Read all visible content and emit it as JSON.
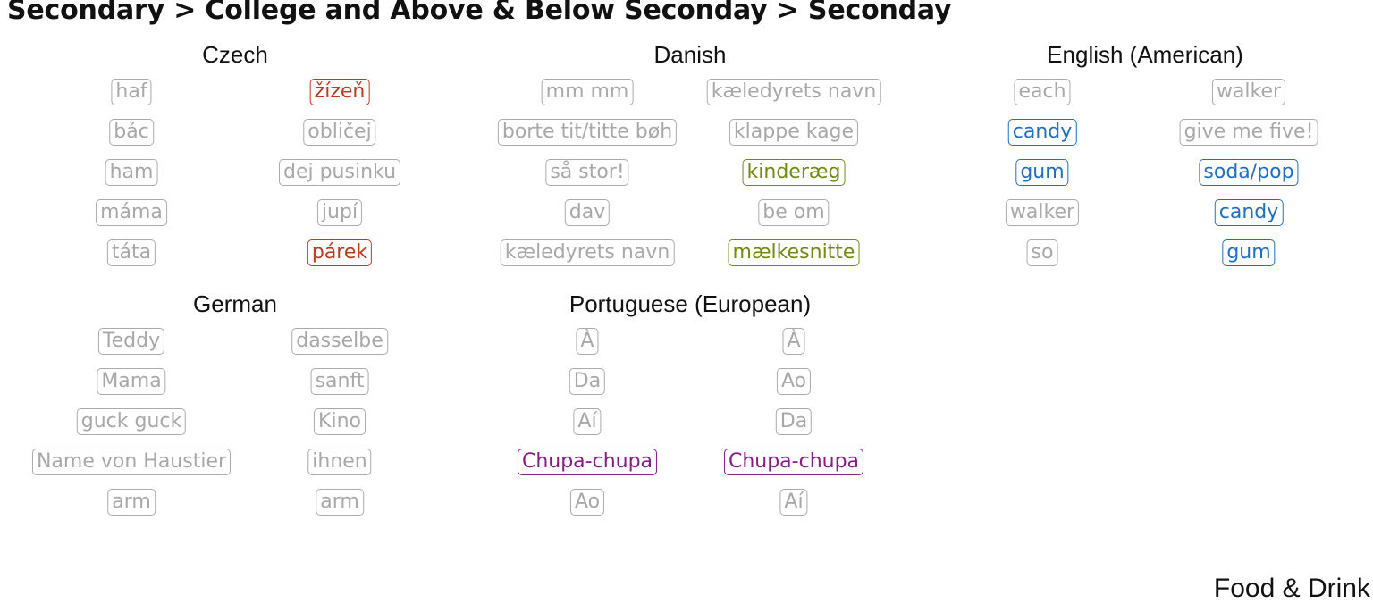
{
  "title": "Secondary > College and Above & Below Seconday > Seconday",
  "footer": "Food & Drink",
  "colors": {
    "default": "#a8a8a8",
    "Czech": "#c0391b",
    "Danish": "#6f8b12",
    "English (American)": "#1f6fc4",
    "Portuguese (European)": "#8a1a8a"
  },
  "panels": [
    {
      "name": "Czech",
      "columns": [
        [
          {
            "text": "haf",
            "hl": false
          },
          {
            "text": "bác",
            "hl": false
          },
          {
            "text": "ham",
            "hl": false
          },
          {
            "text": "máma",
            "hl": false
          },
          {
            "text": "táta",
            "hl": false
          }
        ],
        [
          {
            "text": "žízeň",
            "hl": true
          },
          {
            "text": "obličej",
            "hl": false
          },
          {
            "text": "dej pusinku",
            "hl": false
          },
          {
            "text": "jupí",
            "hl": false
          },
          {
            "text": "párek",
            "hl": true
          }
        ]
      ]
    },
    {
      "name": "Danish",
      "columns": [
        [
          {
            "text": "mm mm",
            "hl": false
          },
          {
            "text": "borte tit/titte bøh",
            "hl": false
          },
          {
            "text": "så stor!",
            "hl": false
          },
          {
            "text": "dav",
            "hl": false
          },
          {
            "text": "kæledyrets navn",
            "hl": false
          }
        ],
        [
          {
            "text": "kæledyrets navn",
            "hl": false
          },
          {
            "text": "klappe kage",
            "hl": false
          },
          {
            "text": "kinderæg",
            "hl": true
          },
          {
            "text": "be om",
            "hl": false
          },
          {
            "text": "mælkesnitte",
            "hl": true
          }
        ]
      ]
    },
    {
      "name": "English (American)",
      "columns": [
        [
          {
            "text": "each",
            "hl": false
          },
          {
            "text": "candy",
            "hl": true
          },
          {
            "text": "gum",
            "hl": true
          },
          {
            "text": "walker",
            "hl": false
          },
          {
            "text": "so",
            "hl": false
          }
        ],
        [
          {
            "text": "walker",
            "hl": false
          },
          {
            "text": "give me five!",
            "hl": false
          },
          {
            "text": "soda/pop",
            "hl": true
          },
          {
            "text": "candy",
            "hl": true
          },
          {
            "text": "gum",
            "hl": true
          }
        ]
      ]
    },
    {
      "name": "German",
      "columns": [
        [
          {
            "text": "Teddy",
            "hl": false
          },
          {
            "text": "Mama",
            "hl": false
          },
          {
            "text": "guck guck",
            "hl": false
          },
          {
            "text": "Name von Haustier",
            "hl": false
          },
          {
            "text": "arm",
            "hl": false
          }
        ],
        [
          {
            "text": "dasselbe",
            "hl": false
          },
          {
            "text": "sanft",
            "hl": false
          },
          {
            "text": "Kino",
            "hl": false
          },
          {
            "text": "ihnen",
            "hl": false
          },
          {
            "text": "arm",
            "hl": false
          }
        ]
      ]
    },
    {
      "name": "Portuguese (European)",
      "columns": [
        [
          {
            "text": "À",
            "hl": false
          },
          {
            "text": "Da",
            "hl": false
          },
          {
            "text": "Aí",
            "hl": false
          },
          {
            "text": "Chupa-chupa",
            "hl": true
          },
          {
            "text": "Ao",
            "hl": false
          }
        ],
        [
          {
            "text": "À",
            "hl": false
          },
          {
            "text": "Ao",
            "hl": false
          },
          {
            "text": "Da",
            "hl": false
          },
          {
            "text": "Chupa-chupa",
            "hl": true
          },
          {
            "text": "Aí",
            "hl": false
          }
        ]
      ]
    }
  ]
}
